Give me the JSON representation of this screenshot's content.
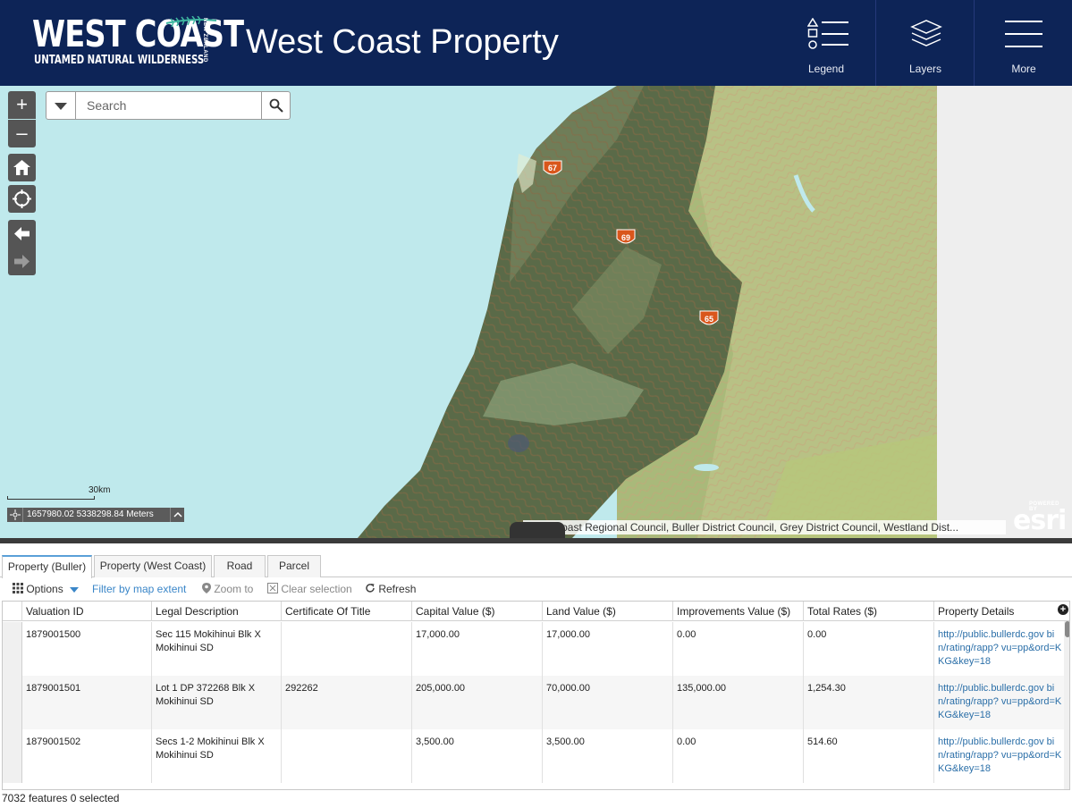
{
  "header": {
    "logo": {
      "main": "WEST COAST",
      "sub": "UNTAMED NATURAL WILDERNESS",
      "country": "NEW ZEALAND"
    },
    "title": "West Coast Property",
    "buttons": [
      {
        "label": "Legend",
        "icon": "legend-icon"
      },
      {
        "label": "Layers",
        "icon": "layers-icon"
      },
      {
        "label": "More",
        "icon": "menu-icon"
      }
    ]
  },
  "map": {
    "zoom_in": "+",
    "zoom_out": "–",
    "search": {
      "placeholder": "Search"
    },
    "scale_label": "30km",
    "coordinates": "1657980.02 5338298.84 Meters",
    "attribution": "West Coast Regional Council, Buller District Council, Grey District Council, Westland Dist...",
    "esri": {
      "powered_by": "POWERED BY",
      "brand": "esri"
    },
    "route_shields": [
      "67",
      "69",
      "65"
    ]
  },
  "table": {
    "tabs": [
      "Property (Buller)",
      "Property (West Coast)",
      "Road",
      "Parcel"
    ],
    "active_tab": "Property (Buller)",
    "toolbar": {
      "options": "Options",
      "filter": "Filter by map extent",
      "zoom_to": "Zoom to",
      "clear": "Clear selection",
      "refresh": "Refresh"
    },
    "columns": [
      "Valuation ID",
      "Legal Description",
      "Certificate Of Title",
      "Capital Value ($)",
      "Land Value ($)",
      "Improvements Value ($)",
      "Total Rates ($)",
      "Property Details"
    ],
    "rows": [
      [
        "1879001500",
        "Sec 115 Mokihinui Blk X Mokihinui SD",
        "",
        "17,000.00",
        "17,000.00",
        "0.00",
        "0.00",
        "http://public.bullerdc.gov bin/rating/rapp? vu=pp&ord=KKG&key=18"
      ],
      [
        "1879001501",
        "Lot 1 DP 372268 Blk X Mokihinui SD",
        "292262",
        "205,000.00",
        "70,000.00",
        "135,000.00",
        "1,254.30",
        "http://public.bullerdc.gov bin/rating/rapp? vu=pp&ord=KKG&key=18"
      ],
      [
        "1879001502",
        "Secs 1-2 Mokihinui Blk X Mokihinui SD",
        "",
        "3,500.00",
        "3,500.00",
        "0.00",
        "514.60",
        "http://public.bullerdc.gov bin/rating/rapp? vu=pp&ord=KKG&key=18"
      ]
    ],
    "footer": "7032 features 0 selected"
  },
  "colors": {
    "header_bg": "#0d2457",
    "sea": "#bfe9ec",
    "link": "#2b6fa8",
    "accent": "#3a86c8"
  }
}
